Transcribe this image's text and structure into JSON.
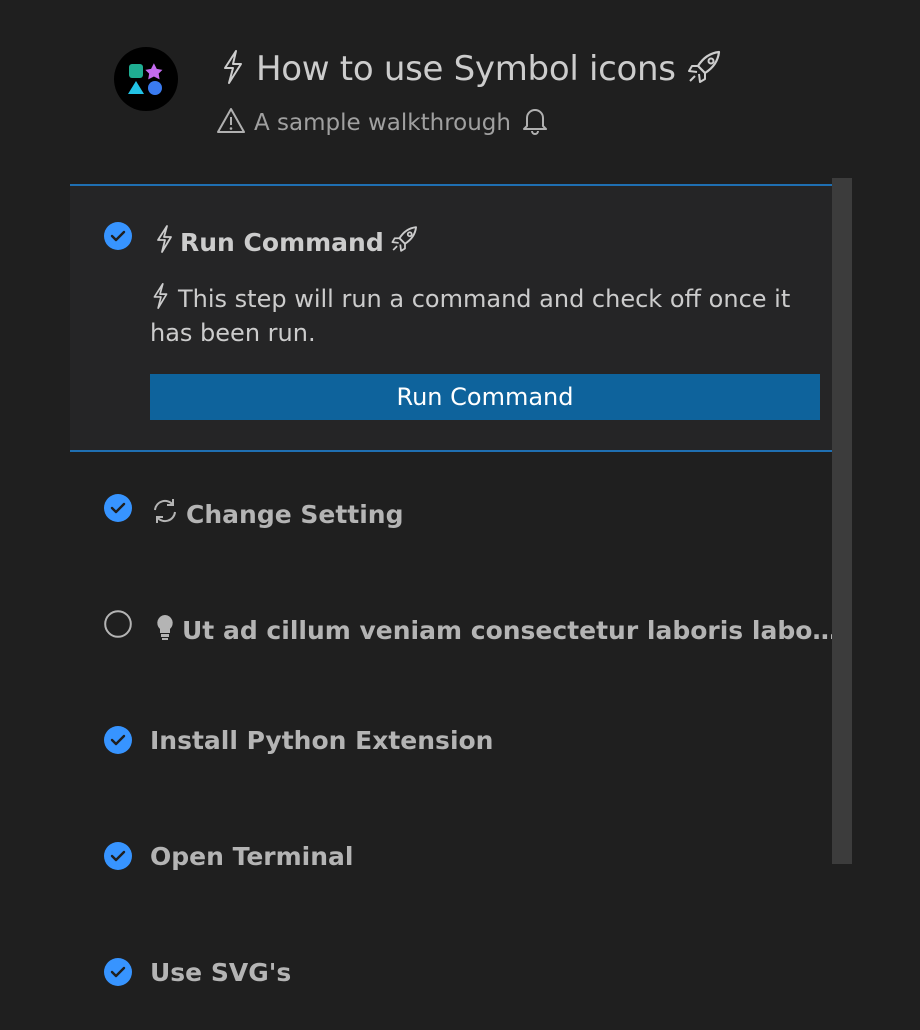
{
  "header": {
    "title": "How to use Symbol icons",
    "subtitle": "A sample walkthrough"
  },
  "steps": [
    {
      "title": "Run Command",
      "completed": true,
      "expanded": true,
      "description": "This step will run a command and check off once it has been run.",
      "button_label": "Run Command",
      "icons": [
        "zap-icon",
        "rocket-icon"
      ]
    },
    {
      "title": "Change Setting",
      "completed": true,
      "icon": "sync-icon"
    },
    {
      "title": "Ut ad cillum veniam consectetur laboris laborum u...",
      "completed": false,
      "icon": "lightbulb-icon"
    },
    {
      "title": "Install Python Extension",
      "completed": true
    },
    {
      "title": "Open Terminal",
      "completed": true
    },
    {
      "title": "Use SVG's",
      "completed": true
    }
  ],
  "colors": {
    "background": "#1f1f1f",
    "panel": "#252526",
    "accent": "#1f6fb2",
    "button": "#0e639c",
    "check": "#3794ff"
  }
}
